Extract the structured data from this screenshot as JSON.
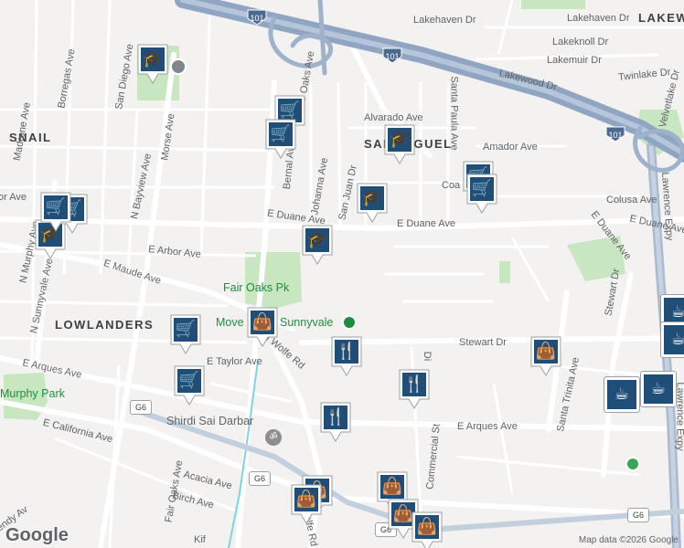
{
  "map": {
    "neighborhoods": [
      "SNAIL",
      "SAN MIGUEL",
      "LOWLANDERS",
      "LAKEWOOD"
    ],
    "streets": [
      "Lakehaven Dr",
      "Lakehaven Dr",
      "Lakeknoll Dr",
      "Lakemuir Dr",
      "Lakewood Dr",
      "Twinlake Dr",
      "Alvarado Ave",
      "Amador Ave",
      "Colusa Ave",
      "Coa",
      "Santa Paula Ave",
      "San Diego Ave",
      "Morse Ave",
      "Borregas Ave",
      "Madrone Ave",
      "N Bayview Ave",
      "Bernal Ave",
      "Johanna Ave",
      "San Juan Dr",
      "Fair Oaks Ave",
      "E Duane Ave",
      "E Duane Ave",
      "E Duane Ave",
      "E Duane Ave",
      "E Arbor Ave",
      "E Maude Ave",
      "N Murphy Ave",
      "N Sunnyvale Ave",
      "Stewart Dr",
      "Stewart Dr",
      "E Taylor Ave",
      "E Arques Ave",
      "E Arques Ave",
      "E California Ave",
      "Acacia Ave",
      "Birch Ave",
      "Fair Oaks Ave",
      "Commercial St",
      "Santa Trinita Ave",
      "Lawrence Expy",
      "Velvetlake Dr",
      "N Wolfe Rd",
      "Wolfe Rd",
      "endy Av",
      "Kif",
      "or Ave",
      "Di",
      "Lawrence Expy"
    ],
    "parks": [
      "Fair Oaks Pk",
      "Murphy Park"
    ],
    "pois": [
      "Move",
      "Sunnyvale",
      "Shirdi Sai Darbar"
    ],
    "highway_shields": [
      "101",
      "101",
      "101"
    ],
    "route_shields": [
      "G6",
      "G6",
      "G6",
      "G6",
      "G6"
    ],
    "attribution": "Map data ©2026 Google",
    "logo": "Google",
    "marker_icons": {
      "school": "school-icon",
      "grocery": "shopping-cart-icon",
      "restaurant": "fork-knife-icon",
      "shop": "shopping-bag-icon",
      "cafe": "coffee-cup-icon"
    },
    "colors": {
      "marker": "#1f4e79",
      "freeway": "#8fa5c1",
      "park": "#c8e6c0",
      "water": "#7fd3e6",
      "background": "#f3f2f1"
    }
  }
}
